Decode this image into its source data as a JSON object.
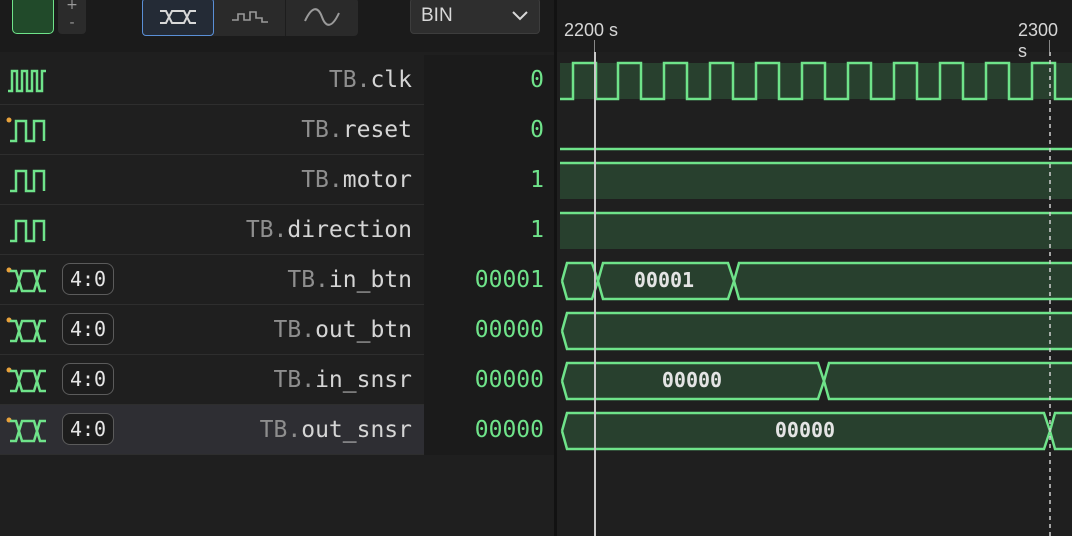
{
  "toolbar": {
    "stepper_plus": "+",
    "stepper_minus": "-",
    "radix": "BIN",
    "accent_color": "#6fe38a"
  },
  "timeline": {
    "labels": [
      "2200 s",
      "2300 s"
    ]
  },
  "signals": [
    {
      "scope": "TB.",
      "name": "clk",
      "value": "0",
      "icon": "clock-signal-icon"
    },
    {
      "scope": "TB.",
      "name": "reset",
      "value": "0",
      "icon": "bit-signal-icon"
    },
    {
      "scope": "TB.",
      "name": "motor",
      "value": "1",
      "icon": "bit-signal-icon"
    },
    {
      "scope": "TB.",
      "name": "direction",
      "value": "1",
      "icon": "bit-signal-icon"
    },
    {
      "scope": "TB.",
      "name": "in_btn",
      "value": "00001",
      "width": "4:0",
      "icon": "bus-signal-icon"
    },
    {
      "scope": "TB.",
      "name": "out_btn",
      "value": "00000",
      "width": "4:0",
      "icon": "bus-signal-icon"
    },
    {
      "scope": "TB.",
      "name": "in_snsr",
      "value": "00000",
      "width": "4:0",
      "icon": "bus-signal-icon"
    },
    {
      "scope": "TB.",
      "name": "out_snsr",
      "value": "00000",
      "width": "4:0",
      "icon": "bus-signal-icon"
    }
  ],
  "waveform": {
    "bus_labels": [
      "00001",
      "00000",
      "00000"
    ]
  }
}
